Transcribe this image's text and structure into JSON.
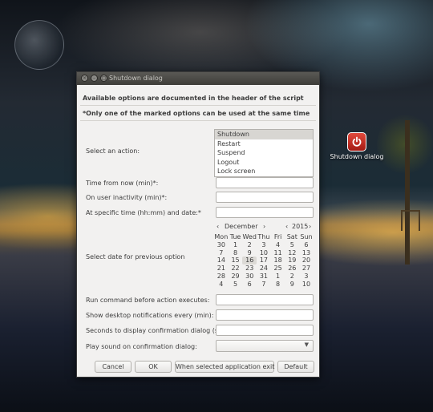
{
  "window": {
    "title": "Shutdown dialog",
    "controls": {
      "close": "×",
      "minimize": "–",
      "maximize": "□"
    }
  },
  "header": {
    "line1": "Available options are documented in the header of the script",
    "line2": "*Only one of the marked options can be used at the same time"
  },
  "form": {
    "action_label": "Select an action:",
    "actions": [
      "Shutdown",
      "Restart",
      "Suspend",
      "Logout",
      "Lock screen"
    ],
    "selected_action": "Shutdown",
    "time_from_now_label": "Time from now (min)*:",
    "inactivity_label": "On user inactivity (min)*:",
    "specific_time_label": "At specific time (hh:mm) and date:*",
    "date_label": "Select date for previous option",
    "run_command_label": "Run command before action executes:",
    "notifications_label": "Show desktop notifications every (min):",
    "confirm_seconds_label": "Seconds to display confirmation dialog (s):",
    "sound_label": "Play sound on confirmation dialog:",
    "time_from_now_value": "",
    "inactivity_value": "",
    "specific_time_value": "",
    "run_command_value": "",
    "notifications_value": "",
    "confirm_seconds_value": "",
    "sound_value": ""
  },
  "calendar": {
    "month": "December",
    "year": "2015",
    "prev": "‹",
    "next": "›",
    "weekdays": [
      "Mon",
      "Tue",
      "Wed",
      "Thu",
      "Fri",
      "Sat",
      "Sun"
    ],
    "weeks": [
      [
        "30",
        "1",
        "2",
        "3",
        "4",
        "5",
        "6"
      ],
      [
        "7",
        "8",
        "9",
        "10",
        "11",
        "12",
        "13"
      ],
      [
        "14",
        "15",
        "16",
        "17",
        "18",
        "19",
        "20"
      ],
      [
        "21",
        "22",
        "23",
        "24",
        "25",
        "26",
        "27"
      ],
      [
        "28",
        "29",
        "30",
        "31",
        "1",
        "2",
        "3"
      ],
      [
        "4",
        "5",
        "6",
        "7",
        "8",
        "9",
        "10"
      ]
    ],
    "selected_day": "16"
  },
  "buttons": {
    "cancel": "Cancel",
    "ok": "OK",
    "when_exit": "When selected application exit",
    "default": "Default"
  },
  "desktop": {
    "icon_label": "Shutdown dialog",
    "icon": "power-icon"
  }
}
